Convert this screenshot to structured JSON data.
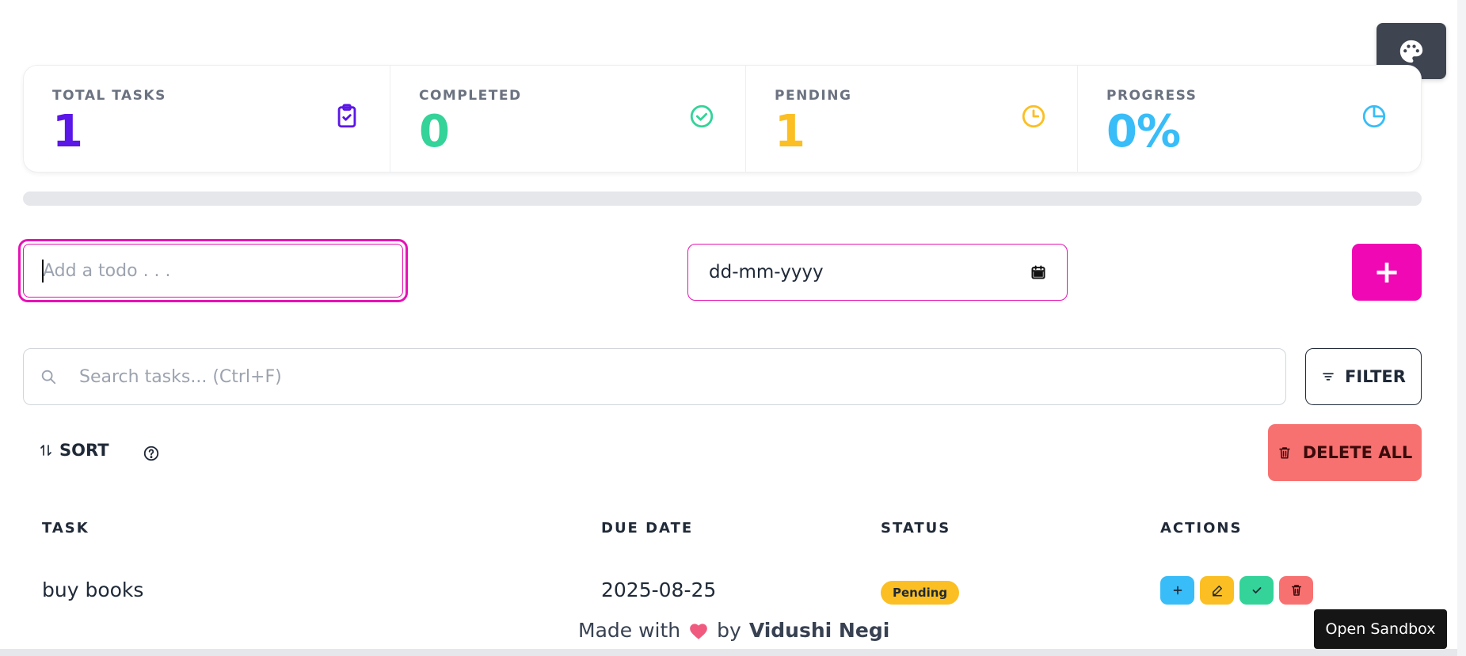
{
  "stats": [
    {
      "label": "TOTAL TASKS",
      "value": "1",
      "color": "#5b16e8",
      "icon": "clipboard-check-icon"
    },
    {
      "label": "COMPLETED",
      "value": "0",
      "color": "#34d399",
      "icon": "check-circle-icon"
    },
    {
      "label": "PENDING",
      "value": "1",
      "color": "#fbbf24",
      "icon": "clock-icon"
    },
    {
      "label": "PROGRESS",
      "value": "0%",
      "color": "#38bdf8",
      "icon": "pie-chart-icon"
    }
  ],
  "progress": {
    "fraction": 0
  },
  "form": {
    "todo_placeholder": "Add a todo . . .",
    "date_placeholder": "dd-mm-yyyy",
    "add_label": "+"
  },
  "search": {
    "placeholder": "Search tasks... (Ctrl+F)"
  },
  "filter": {
    "label": "FILTER"
  },
  "sort": {
    "label": "SORT"
  },
  "delete_all": {
    "label": "DELETE ALL"
  },
  "table": {
    "headers": [
      "TASK",
      "DUE DATE",
      "STATUS",
      "ACTIONS"
    ],
    "rows": [
      {
        "task": "buy books",
        "due": "2025-08-25",
        "status": "Pending"
      }
    ]
  },
  "footer": {
    "prefix": "Made with",
    "by": "by",
    "author": "Vidushi Negi"
  },
  "sandbox": {
    "label": "Open Sandbox"
  },
  "colors": {
    "accent": "#ef08b4",
    "danger": "#f87171",
    "info": "#38bdf8",
    "warning": "#fbbf24",
    "success": "#34d399"
  }
}
